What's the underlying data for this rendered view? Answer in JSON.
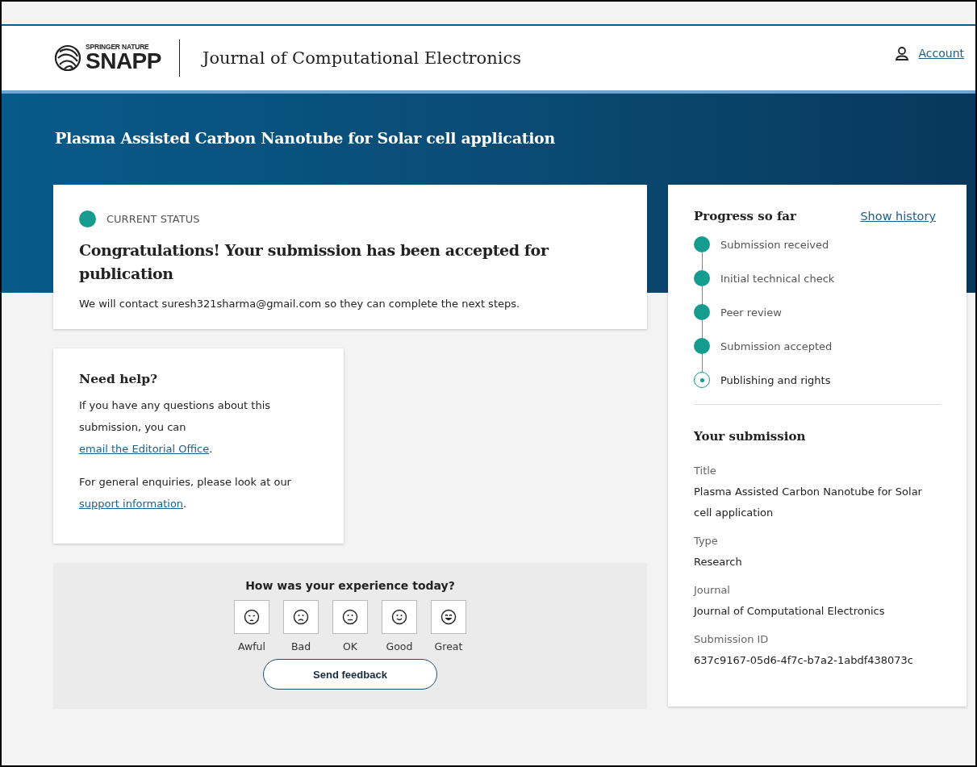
{
  "header": {
    "brand_small": "SPRINGER NATURE",
    "brand": "SNAPP",
    "journal": "Journal of Computational Electronics",
    "account": "Account"
  },
  "banner": {
    "title": "Plasma Assisted Carbon Nanotube for Solar cell application"
  },
  "status": {
    "label": "CURRENT STATUS",
    "color": "#159b8f",
    "heading": "Congratulations! Your submission has been accepted for publication",
    "message": "We will contact suresh321sharma@gmail.com so they can complete the next steps."
  },
  "help": {
    "heading": "Need help?",
    "paragraphs": [
      {
        "before": "If you have any questions about this submission, you can ",
        "link": "email the Editorial Office",
        "after": "."
      },
      {
        "before": "For general enquiries, please look at our ",
        "link": "support information",
        "after": "."
      }
    ]
  },
  "feedback": {
    "question": "How was your experience today?",
    "options": [
      {
        "label": "Awful",
        "selected": false
      },
      {
        "label": "Bad",
        "selected": false
      },
      {
        "label": "OK",
        "selected": false
      },
      {
        "label": "Good",
        "selected": false
      },
      {
        "label": "Great",
        "selected": false
      }
    ],
    "button": "Send feedback"
  },
  "progress": {
    "heading": "Progress so far",
    "link": "Show history",
    "steps": [
      {
        "label": "Submission received",
        "done": true
      },
      {
        "label": "Initial technical check",
        "done": true
      },
      {
        "label": "Peer review",
        "done": true
      },
      {
        "label": "Submission accepted",
        "done": true
      },
      {
        "label": "Publishing and rights",
        "done": false
      }
    ]
  },
  "submission": {
    "heading": "Your submission",
    "fields": [
      {
        "label": "Title",
        "value": "Plasma Assisted Carbon Nanotube for Solar cell application"
      },
      {
        "label": "Type",
        "value": "Research"
      },
      {
        "label": "Journal",
        "value": "Journal of Computational Electronics"
      },
      {
        "label": "Submission ID",
        "value": "637c9167-05d6-4f7c-b7a2-1abdf438073c"
      }
    ]
  }
}
